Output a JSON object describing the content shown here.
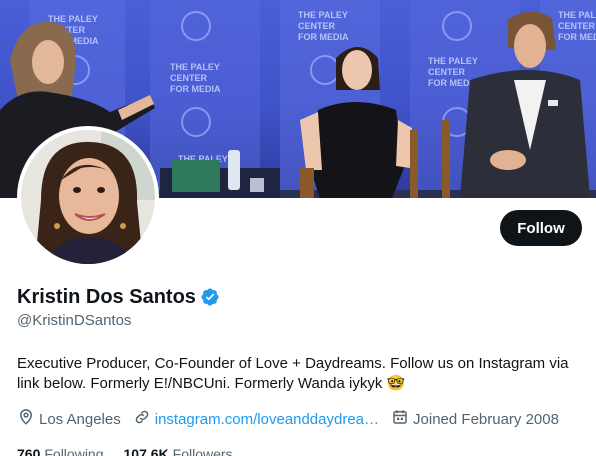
{
  "banner": {
    "sign_text_lines": [
      "THE PALEY",
      "CENTER",
      "FOR MEDIA"
    ]
  },
  "profile": {
    "display_name": "Kristin Dos Santos",
    "handle": "@KristinDSantos",
    "verified": true,
    "bio": "Executive Producer, Co-Founder of Love + Daydreams. Follow us on Instagram via link below. Formerly E!/NBCUni. Formerly Wanda iykyk 🤓",
    "location": "Los Angeles",
    "website": "instagram.com/loveanddaydrea…",
    "joined": "Joined February 2008",
    "following_count": "760",
    "following_label": "Following",
    "followers_count": "107.6K",
    "followers_label": "Followers"
  },
  "actions": {
    "follow_label": "Follow"
  },
  "colors": {
    "accent": "#1d9bf0",
    "text_primary": "#0f1419",
    "text_secondary": "#536471",
    "button_bg": "#0f1419",
    "banner_blue": "#4a5fd6"
  },
  "icons": [
    "verified-badge-icon",
    "location-pin-icon",
    "link-icon",
    "calendar-icon"
  ]
}
